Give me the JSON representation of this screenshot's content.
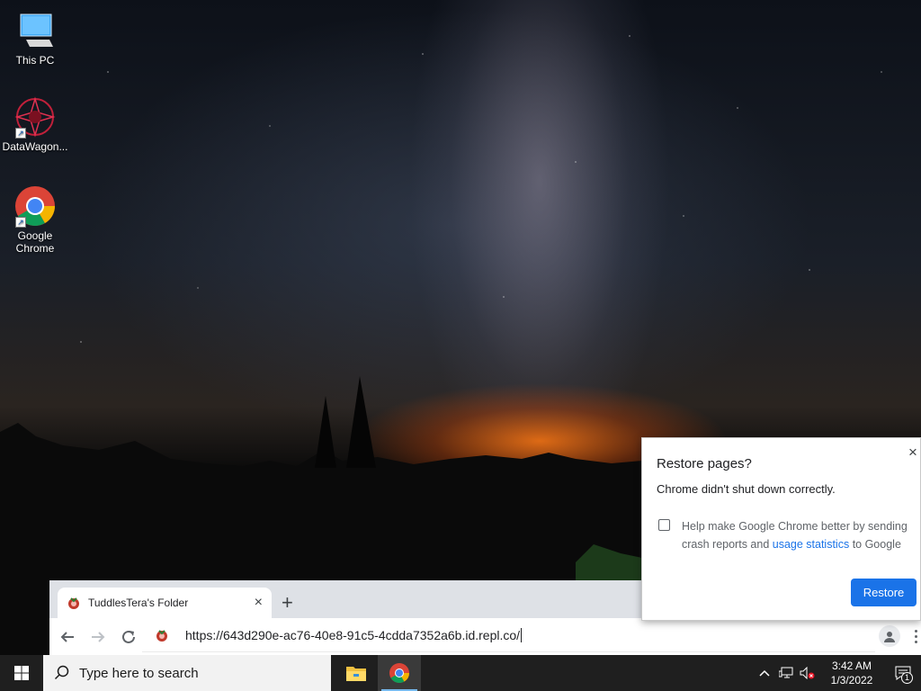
{
  "desktop": {
    "icons": [
      {
        "label": "This PC",
        "icon": "computer-icon"
      },
      {
        "label": "DataWagon...",
        "icon": "datawagon-icon"
      },
      {
        "label": "Google Chrome",
        "icon": "chrome-icon"
      }
    ]
  },
  "browser": {
    "tab_title": "TuddlesTera's Folder",
    "tab_close": "×",
    "new_tab": "+",
    "url": "https://643d290e-ac76-40e8-91c5-4cdda7352a6b.id.repl.co/"
  },
  "restore_dialog": {
    "title": "Restore pages?",
    "close": "×",
    "message": "Chrome didn't shut down correctly.",
    "help_text_before": "Help make Google Chrome better by sending crash reports and ",
    "help_link": "usage statistics",
    "help_text_after": " to Google",
    "checkbox_checked": false,
    "restore_button": "Restore",
    "accent_color": "#1a73e8"
  },
  "taskbar": {
    "search_placeholder": "Type here to search",
    "pinned_apps": [
      "file-explorer-icon",
      "chrome-icon"
    ],
    "clock_time": "3:42 AM",
    "clock_date": "1/3/2022",
    "notification_count": "1"
  }
}
